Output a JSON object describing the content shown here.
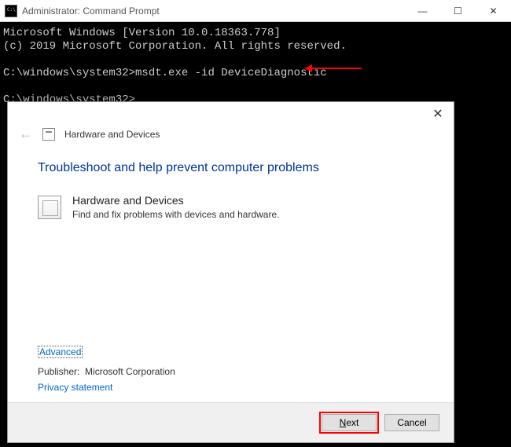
{
  "cmd": {
    "title": "Administrator: Command Prompt",
    "line1": "Microsoft Windows [Version 10.0.18363.778]",
    "line2": "(c) 2019 Microsoft Corporation. All rights reserved.",
    "prompt1_path": "C:\\windows\\system32>",
    "prompt1_cmd": "msdt.exe -id DeviceDiagnostic",
    "prompt2_path": "C:\\windows\\system32>"
  },
  "dialog": {
    "header_title": "Hardware and Devices",
    "headline": "Troubleshoot and help prevent computer problems",
    "item_title": "Hardware and Devices",
    "item_desc": "Find and fix problems with devices and hardware.",
    "advanced": "Advanced",
    "publisher_label": "Publisher:",
    "publisher_value": "Microsoft Corporation",
    "privacy": "Privacy statement",
    "next": "Next",
    "cancel": "Cancel"
  }
}
